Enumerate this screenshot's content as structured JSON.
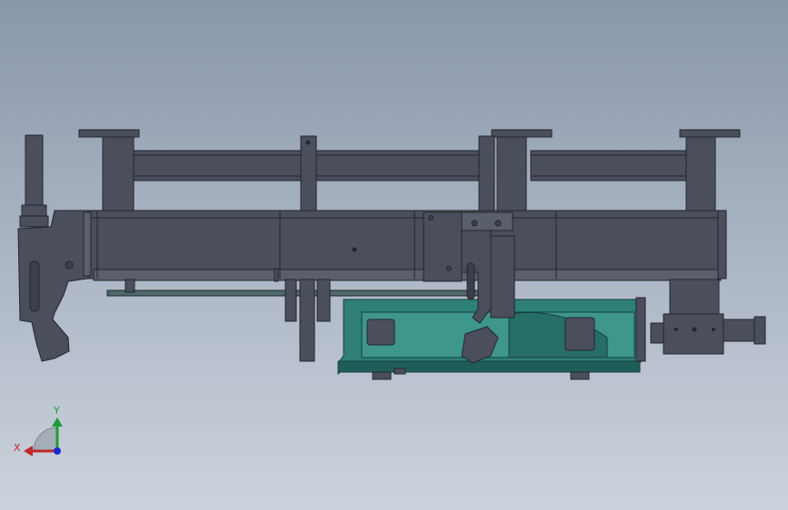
{
  "triad": {
    "x_label": "X",
    "y_label": "Y",
    "x_color": "#c0282c",
    "y_color": "#1f9a3a",
    "z_color": "#1a2ad0"
  },
  "colors": {
    "background_top": "#8a97aa",
    "background_bottom": "#ccd3dc",
    "steel": "#4b4f5c",
    "steel_light": "#5a5f6c",
    "outline": "#23262e",
    "teal_housing": "#2e7f77",
    "teal_dark": "#1f5e58",
    "teal_light": "#3e968c"
  }
}
